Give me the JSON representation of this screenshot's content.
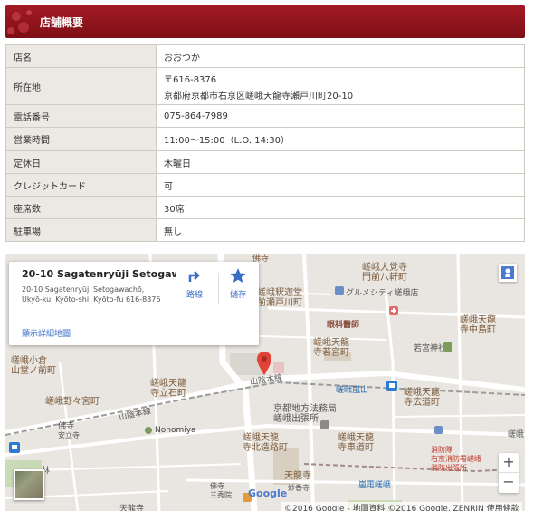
{
  "header": {
    "title": "店舗概要"
  },
  "info_rows": [
    {
      "label": "店名",
      "value": "おおつか",
      "value2": ""
    },
    {
      "label": "所在地",
      "value": "〒616-8376",
      "value2": "京都府京都市右京区嵯峨天龍寺瀬戸川町20-10"
    },
    {
      "label": "電話番号",
      "value": "075-864-7989",
      "value2": ""
    },
    {
      "label": "営業時間",
      "value": "11:00～15:00（L.O. 14:30）",
      "value2": ""
    },
    {
      "label": "定休日",
      "value": "木曜日",
      "value2": ""
    },
    {
      "label": "クレジットカード",
      "value": "可",
      "value2": ""
    },
    {
      "label": "座席数",
      "value": "30席",
      "value2": ""
    },
    {
      "label": "駐車場",
      "value": "無し",
      "value2": ""
    }
  ],
  "map": {
    "card": {
      "name": "20-10 Sagatenryūji Setogawa...",
      "address": "20-10 Sagatenryūji Setogawachō, Ukyō-ku, Kyōto-shi, Kyōto-fu 616-8376",
      "directions": "路線",
      "save": "儲存",
      "view_larger": "顯示詳細地圖"
    },
    "labels": {
      "bukkyo_top": "佛寺",
      "saga_daikakuji": "嵯峨大覚寺\n門前八軒町",
      "saga_shakado": "嵯峨釈迦堂\n前瀬戸川町",
      "gourmet_city": "グルメシティ嵯峨店",
      "ganka": "眼科醫師",
      "tenryuji_nakajima": "嵯峨天龍\n寺中島町",
      "tenryuji_wakamiya": "嵯峨天龍\n寺若宮町",
      "wakamiya_shrine": "若宮神社",
      "ogura": "嵯峨小倉\n山堂ノ前町",
      "tenryuji_tatehishi": "嵯峨天龍\n寺立石町",
      "sanin_line_1": "山陰本線",
      "sanin_line_2": "山陰本線",
      "saga_arashiyama": "嵯峨嵐山",
      "tenryuji_hiromichi": "嵯峨天龍\n寺広道町",
      "nonomiya_cho": "嵯峨野々宮町",
      "kyoto_office": "京都地方法務局\n嵯峨出張所",
      "bukkyo_mid": "佛寺",
      "anjoji": "安立寺",
      "nonomiya": "Nonomiya",
      "tenryuji_kitazoro": "嵯峨天龍\n寺北造路町",
      "tenryuji_kurumamichi": "嵯峨天龍\n寺車道町",
      "saga_right": "嵯峨",
      "fire_station": "消防隊\n右京消防署嵯峨\n消防出張所",
      "hayashi": "林",
      "tenryuji_bottom": "天龍寺",
      "myouki": "妙香寺",
      "bukkyo_bottom": "佛寺\n三秀院",
      "randen_saga": "嵐電嵯峨",
      "tenryuji_bottom_left": "天龍寺"
    },
    "zoom_in": "+",
    "zoom_out": "−",
    "google": "Google",
    "footer": "©2016 Google - 地圖資料 ©2016 Google, ZENRIN   使用條款"
  },
  "colors": {
    "header_red": "#8e141c",
    "pin_red": "#e14336",
    "road_white": "#ffffff",
    "map_bg": "#e9e6e1"
  }
}
